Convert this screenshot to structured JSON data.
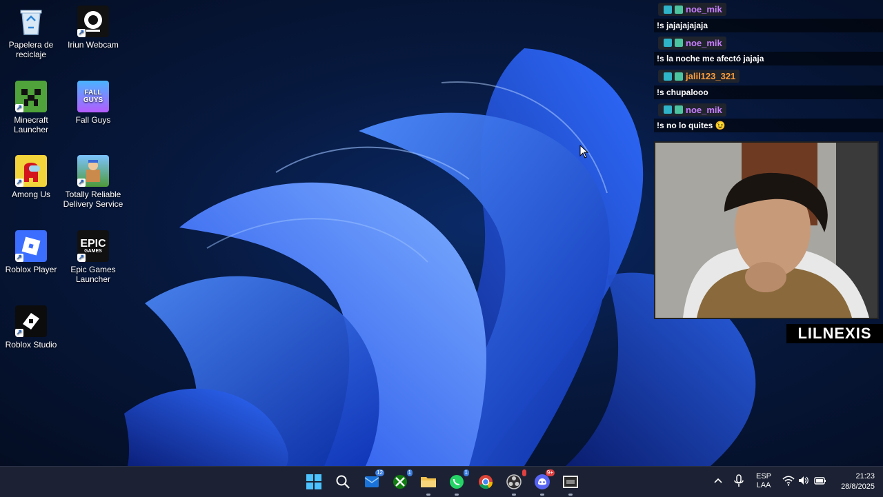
{
  "desktop_icons": [
    {
      "label": "Papelera de reciclaje",
      "icon": "recycle-bin-icon"
    },
    {
      "label": "Iriun Webcam",
      "icon": "iriun-webcam-icon"
    },
    {
      "label": "Minecraft Launcher",
      "icon": "minecraft-icon"
    },
    {
      "label": "Fall Guys",
      "icon": "fall-guys-icon"
    },
    {
      "label": "Among Us",
      "icon": "among-us-icon"
    },
    {
      "label": "Totally Reliable Delivery Service",
      "icon": "delivery-service-icon"
    },
    {
      "label": "Roblox Player",
      "icon": "roblox-player-icon"
    },
    {
      "label": "Epic Games Launcher",
      "icon": "epic-games-icon"
    },
    {
      "label": "Roblox Studio",
      "icon": "roblox-studio-icon"
    }
  ],
  "icon_art": {
    "fall_guys": "FALL GUYS",
    "epic": "EPIC",
    "epic_sub": "GAMES"
  },
  "chat": {
    "messages": [
      {
        "user": "noe_mik",
        "user_color": "#c77dff",
        "text": "!s jajajajajaja"
      },
      {
        "user": "noe_mik",
        "user_color": "#c77dff",
        "text": "!s la noche me afectó jajaja"
      },
      {
        "user": "jalil123_321",
        "user_color": "#ff9f3c",
        "text": "!s chupalooo"
      },
      {
        "user": "noe_mik",
        "user_color": "#c77dff",
        "text": "!s no lo quites 😉"
      }
    ]
  },
  "webcam": {
    "streamer_name": "LILNEXIS"
  },
  "taskbar": {
    "apps": [
      {
        "name": "start-button",
        "icon": "windows-start-icon"
      },
      {
        "name": "search-button",
        "icon": "search-icon"
      },
      {
        "name": "outlook",
        "icon": "outlook-icon",
        "badge": "12"
      },
      {
        "name": "xbox",
        "icon": "xbox-icon",
        "badge": "1"
      },
      {
        "name": "file-explorer",
        "icon": "folder-icon"
      },
      {
        "name": "whatsapp",
        "icon": "whatsapp-icon",
        "badge": "1"
      },
      {
        "name": "chrome",
        "icon": "chrome-icon"
      },
      {
        "name": "obs",
        "icon": "obs-icon"
      },
      {
        "name": "discord",
        "icon": "discord-icon",
        "badge": "9+"
      },
      {
        "name": "game-app",
        "icon": "game-app-icon"
      }
    ],
    "tray": {
      "language_top": "ESP",
      "language_bottom": "LAA",
      "time": "21:23",
      "date": "28/8/2025"
    }
  },
  "colors": {
    "taskbar": "#1c2233",
    "wallpaper_accent": "#1e5bff"
  }
}
